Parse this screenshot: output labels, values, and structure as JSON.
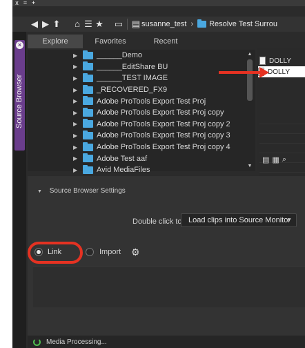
{
  "window": {
    "top_marks": [
      "x",
      "=",
      "+"
    ]
  },
  "toolbar": {
    "icons": [
      "back-icon",
      "forward-icon",
      "up-icon",
      "home-icon",
      "list-icon",
      "star-icon",
      "drive-icon"
    ],
    "breadcrumb": [
      "susanne_test",
      "Resolve Test Surrou"
    ]
  },
  "sidebar": {
    "label": "Source Browser",
    "close": "×"
  },
  "tabs": [
    "Explore",
    "Favorites",
    "Recent"
  ],
  "tree_items": [
    "______Demo",
    "______EditShare BU",
    "______TEST IMAGE",
    "_RECOVERED_FX9",
    "Adobe ProTools Export Test Proj",
    "Adobe ProTools Export Test Proj copy",
    "Adobe ProTools Export Test Proj copy 2",
    "Adobe ProTools Export Test Proj copy 3",
    "Adobe ProTools Export Test Proj copy 4",
    "Adobe Test aaf",
    "Avid MediaFiles"
  ],
  "files": [
    "DOLLY",
    "DOLLY"
  ],
  "settings": {
    "header": "Source Browser Settings",
    "double_click_label": "Double click to:",
    "double_click_value": "Load clips into Source Monitor",
    "link_label": "Link",
    "import_label": "Import"
  },
  "status": {
    "text": "Media Processing..."
  },
  "colors": {
    "accent_folder": "#4aa8e0",
    "annotation": "#e53222",
    "sidebar_tab": "#6a3d8c"
  }
}
